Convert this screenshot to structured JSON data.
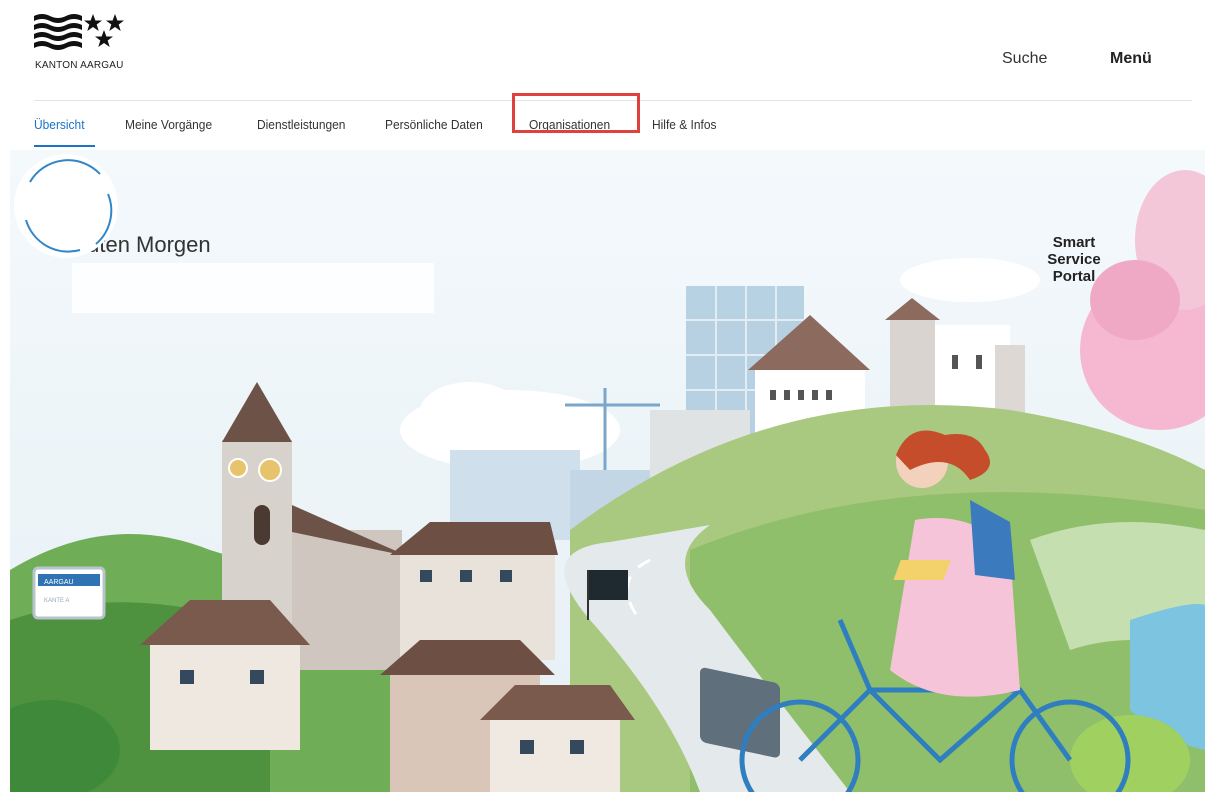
{
  "logo": {
    "text": "KANTON AARGAU"
  },
  "header": {
    "search_label": "Suche",
    "menu_label": "Menü"
  },
  "nav": {
    "items": [
      {
        "label": "Übersicht",
        "active": true
      },
      {
        "label": "Meine Vorgänge",
        "active": false
      },
      {
        "label": "Dienstleistungen",
        "active": false
      },
      {
        "label": "Persönliche Daten",
        "active": false
      },
      {
        "label": "Organisationen",
        "active": false,
        "highlighted": true
      },
      {
        "label": "Hilfe & Infos",
        "active": false
      }
    ]
  },
  "hero": {
    "greeting": "Guten Morgen",
    "badge_lines": [
      "Smart",
      "Service",
      "Portal"
    ],
    "sign_lines": [
      "AARGAU",
      "KANTE A"
    ]
  },
  "colors": {
    "accent": "#1a73c8",
    "highlight_border": "#e0413b"
  }
}
